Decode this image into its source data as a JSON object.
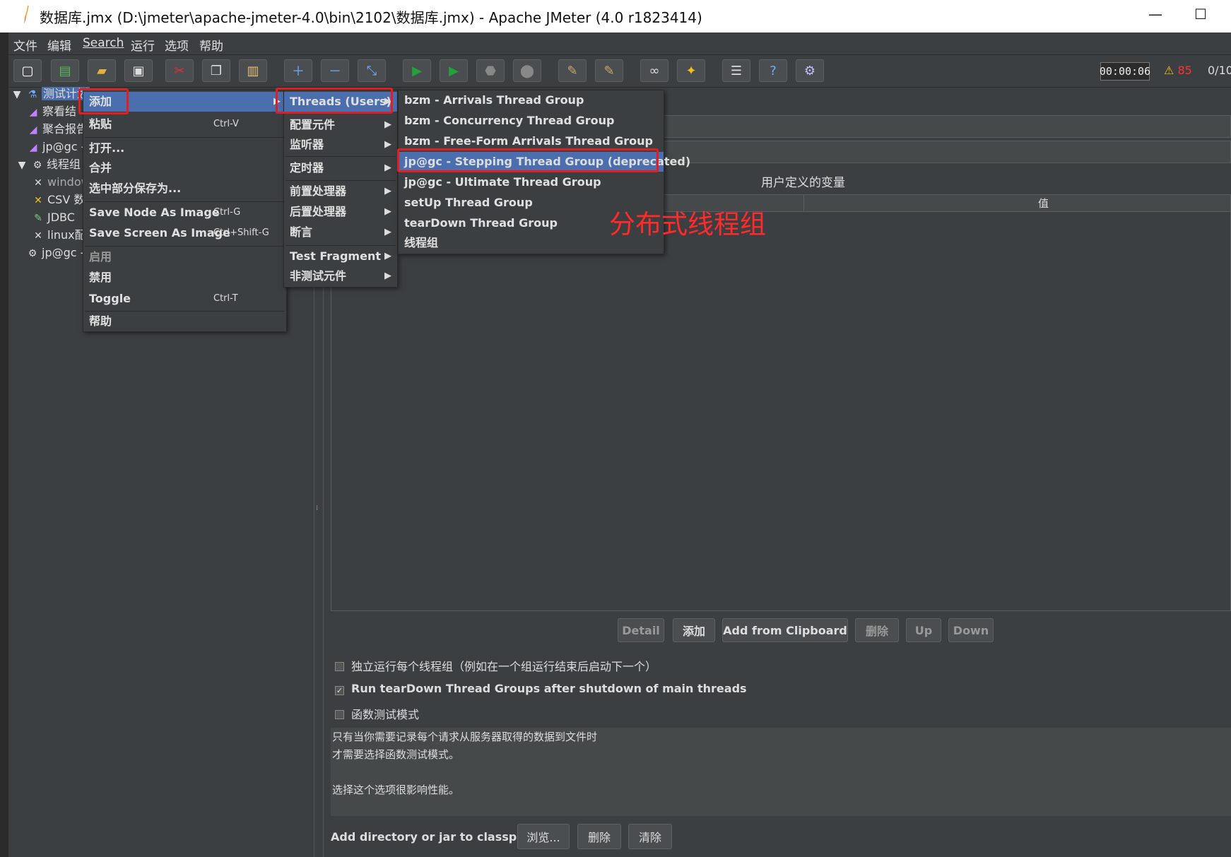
{
  "window": {
    "title": "数据库.jmx (D:\\jmeter\\apache-jmeter-4.0\\bin\\2102\\数据库.jmx) - Apache JMeter (4.0 r1823414)"
  },
  "menubar": [
    "文件",
    "编辑",
    "Search",
    "运行",
    "选项",
    "帮助"
  ],
  "toolbar": {
    "timer": "00:00:06",
    "warning_count": "85",
    "threads": "0/10",
    "accent_play": "#21a33a",
    "warning_color": "#ff3030"
  },
  "tree": {
    "items": [
      {
        "label": "测试计划",
        "icon": "flask-icon"
      },
      {
        "label": "察看结",
        "icon": "graph-icon"
      },
      {
        "label": "聚合报告",
        "icon": "graph-icon"
      },
      {
        "label": "jp@gc -",
        "icon": "graph-icon"
      },
      {
        "label": "线程组",
        "icon": "gear-icon"
      },
      {
        "label": "window",
        "icon": "tools-icon"
      },
      {
        "label": "CSV 数",
        "icon": "tools-icon"
      },
      {
        "label": "JDBC",
        "icon": "pen-icon"
      },
      {
        "label": "linux配",
        "icon": "tools-icon"
      },
      {
        "label": "jp@gc -",
        "icon": "gear-icon"
      }
    ]
  },
  "context_menu": {
    "items": [
      {
        "label": "添加",
        "shortcut": "",
        "submenu": true
      },
      {
        "label": "粘贴",
        "shortcut": "Ctrl-V"
      },
      {
        "label": "打开...",
        "shortcut": ""
      },
      {
        "label": "合并",
        "shortcut": ""
      },
      {
        "label": "选中部分保存为...",
        "shortcut": ""
      },
      {
        "label": "Save Node As Image",
        "shortcut": "Ctrl-G"
      },
      {
        "label": "Save Screen As Image",
        "shortcut": "Ctrl+Shift-G"
      },
      {
        "label": "启用",
        "shortcut": ""
      },
      {
        "label": "禁用",
        "shortcut": ""
      },
      {
        "label": "Toggle",
        "shortcut": "Ctrl-T"
      },
      {
        "label": "帮助",
        "shortcut": ""
      }
    ]
  },
  "add_submenu": {
    "items": [
      "Threads (Users)",
      "配置元件",
      "监听器",
      "定时器",
      "前置处理器",
      "后置处理器",
      "断言",
      "Test Fragment",
      "非测试元件"
    ]
  },
  "threads_submenu": {
    "items": [
      "bzm - Arrivals Thread Group",
      "bzm - Concurrency Thread Group",
      "bzm - Free-Form Arrivals Thread Group",
      "jp@gc - Stepping Thread Group (deprecated)",
      "jp@gc - Ultimate Thread Group",
      "setUp Thread Group",
      "tearDown Thread Group",
      "线程组"
    ]
  },
  "annotation": "分布式线程组",
  "panel": {
    "variables_title": "用户定义的变量",
    "value_column": "值",
    "buttons": [
      "Detail",
      "添加",
      "Add from Clipboard",
      "删除",
      "Up",
      "Down"
    ],
    "checkboxes": [
      {
        "label": "独立运行每个线程组（例如在一个组运行结束后启动下一个）",
        "checked": false
      },
      {
        "label": "Run tearDown Thread Groups after shutdown of main threads",
        "checked": true
      },
      {
        "label": "函数测试模式",
        "checked": false
      }
    ],
    "note_lines": [
      "只有当你需要记录每个请求从服务器取得的数据到文件时",
      "才需要选择函数测试模式。",
      "",
      "选择这个选项很影响性能。"
    ],
    "classpath_label": "Add directory or jar to classpath",
    "classpath_buttons": [
      "浏览...",
      "删除",
      "清除"
    ]
  }
}
